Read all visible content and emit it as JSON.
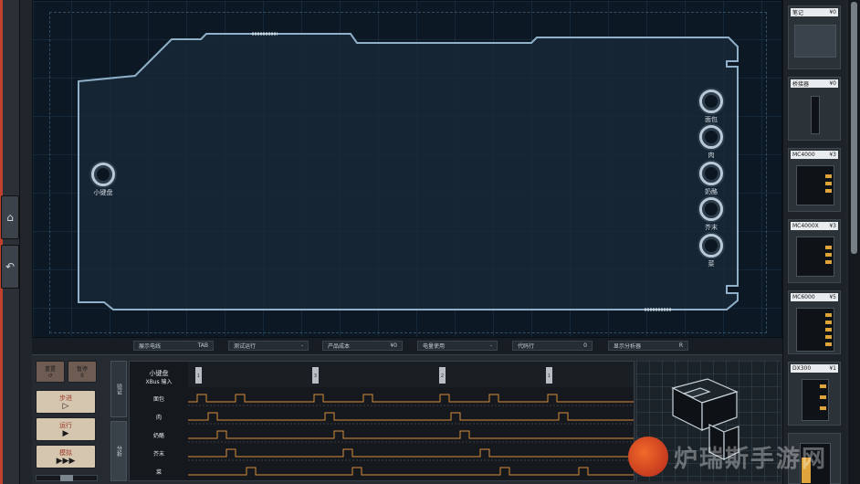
{
  "board": {
    "input_port": {
      "label": "小键盘"
    },
    "output_ports": [
      {
        "label": "面包"
      },
      {
        "label": "肉"
      },
      {
        "label": "奶酪"
      },
      {
        "label": "芥末"
      },
      {
        "label": "菜"
      }
    ]
  },
  "info_bar": {
    "items": [
      {
        "label": "展示电线",
        "value": "TAB"
      },
      {
        "label": "测试运行",
        "value": "-"
      },
      {
        "label": "产品成本",
        "value": "¥0"
      },
      {
        "label": "电量使用",
        "value": "-"
      },
      {
        "label": "代码行",
        "value": "0"
      },
      {
        "label": "显示分析器",
        "value": "R"
      }
    ]
  },
  "controls": {
    "reset_label": "重置",
    "pause_label": "暂停",
    "step_label": "步进",
    "run_label": "运行",
    "fast_label": "模拟",
    "reset_glyph": "↺",
    "pause_glyph": "II",
    "step_glyph": "▷",
    "run_glyph": "▶",
    "fast_glyph": "▶▶▶"
  },
  "tabs": [
    {
      "label": "验证"
    },
    {
      "label": "分析"
    }
  ],
  "waveform": {
    "input_title": "小键盘",
    "input_subtitle": "XBus 输入",
    "markers": [
      "1",
      "3",
      "2",
      "1"
    ],
    "rows": [
      {
        "label": "面包"
      },
      {
        "label": "肉"
      },
      {
        "label": "奶酪"
      },
      {
        "label": "芥末"
      },
      {
        "label": "菜"
      }
    ],
    "signal_color": "#d98a3a"
  },
  "palette": {
    "items": [
      {
        "name": "笔记",
        "price": "¥0"
      },
      {
        "name": "桥接器",
        "price": "¥0"
      },
      {
        "name": "MC4000",
        "price": "¥3"
      },
      {
        "name": "MC4000X",
        "price": "¥3"
      },
      {
        "name": "MC6000",
        "price": "¥5"
      },
      {
        "name": "DX300",
        "price": "¥1"
      }
    ]
  },
  "watermark": {
    "text": "炉瑞斯手游网"
  },
  "icons": {
    "home": "home-icon",
    "undo": "undo-icon"
  },
  "colors": {
    "board_bg": "#0c1824",
    "accent_orange": "#d98a3a",
    "pin_gold": "#e0a53a"
  }
}
